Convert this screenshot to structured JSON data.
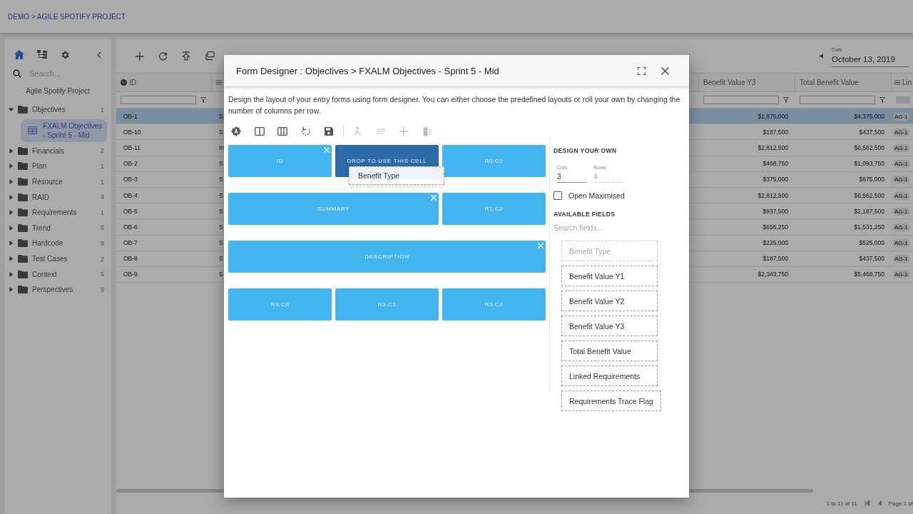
{
  "breadcrumb": "DEMO > AGILE SPOTIFY PROJECT",
  "sidebar": {
    "search_placeholder": "Search...",
    "project": "Agile Spotify Project",
    "tree": [
      {
        "label": "Objectives",
        "count": "1",
        "expanded": true,
        "children": [
          {
            "label": "FXALM Objectives - Sprint 5 - Mid",
            "selected": true
          }
        ]
      },
      {
        "label": "Financials",
        "count": "2",
        "expanded": false
      },
      {
        "label": "Plan",
        "count": "1",
        "expanded": false
      },
      {
        "label": "Resource",
        "count": "1",
        "expanded": false
      },
      {
        "label": "RAID",
        "count": "4",
        "expanded": false
      },
      {
        "label": "Requirements",
        "count": "1",
        "expanded": false
      },
      {
        "label": "Trend",
        "count": "6",
        "expanded": false
      },
      {
        "label": "Hardcode",
        "count": "9",
        "expanded": false
      },
      {
        "label": "Test Cases",
        "count": "2",
        "expanded": false
      },
      {
        "label": "Context",
        "count": "5",
        "expanded": false
      },
      {
        "label": "Perspectives",
        "count": "9",
        "expanded": false
      }
    ]
  },
  "date_field": {
    "label": "Date",
    "value": "October 13, 2019"
  },
  "table": {
    "headers": {
      "id": "ID",
      "benefit_value_y3": "Benefit Value Y3",
      "total_benefit_value": "Total Benefit Value",
      "column_last": "Lin"
    },
    "rows": [
      {
        "id": "OB-1",
        "column_2": "S",
        "benefit_value_y3": "$1,875,000",
        "total_benefit_value": "$4,375,000",
        "column_last": "AG-1",
        "selected": true
      },
      {
        "id": "OB-10",
        "column_2": "S",
        "benefit_value_y3": "$187,500",
        "total_benefit_value": "$437,500",
        "column_last": "AG-1",
        "selected": false
      },
      {
        "id": "OB-11",
        "column_2": "In",
        "benefit_value_y3": "$2,812,500",
        "total_benefit_value": "$6,562,500",
        "column_last": "AG-1",
        "selected": false
      },
      {
        "id": "OB-2",
        "column_2": "S",
        "benefit_value_y3": "$468,750",
        "total_benefit_value": "$1,093,750",
        "column_last": "AG-1",
        "selected": false
      },
      {
        "id": "OB-3",
        "column_2": "S",
        "benefit_value_y3": "$375,000",
        "total_benefit_value": "$875,000",
        "column_last": "AG-1",
        "selected": false
      },
      {
        "id": "OB-4",
        "column_2": "S",
        "benefit_value_y3": "$2,812,500",
        "total_benefit_value": "$6,562,500",
        "column_last": "AG-1",
        "selected": false
      },
      {
        "id": "OB-5",
        "column_2": "S",
        "benefit_value_y3": "$937,500",
        "total_benefit_value": "$2,187,500",
        "column_last": "AG-1",
        "selected": false
      },
      {
        "id": "OB-6",
        "column_2": "S",
        "benefit_value_y3": "$656,250",
        "total_benefit_value": "$1,531,250",
        "column_last": "AG-1",
        "selected": false
      },
      {
        "id": "OB-7",
        "column_2": "S",
        "benefit_value_y3": "$225,000",
        "total_benefit_value": "$525,000",
        "column_last": "AG-1",
        "selected": false
      },
      {
        "id": "OB-8",
        "column_2": "S",
        "benefit_value_y3": "$187,500",
        "total_benefit_value": "$437,500",
        "column_last": "AG-1",
        "selected": false
      },
      {
        "id": "OB-9",
        "column_2": "S",
        "benefit_value_y3": "$2,343,750",
        "total_benefit_value": "$5,468,750",
        "column_last": "AG-1",
        "selected": false
      }
    ]
  },
  "footer": {
    "count": "1 to 11 of 11",
    "page": "Page 1 of"
  },
  "modal": {
    "title": "Form Designer : Objectives > FXALM Objectives - Sprint 5 - Mid",
    "description": "Design the layout of your entry forms using form designer. You can either choose the predefined layouts or roll your own by changing the number of columns per row.",
    "tools": [
      {
        "kind": "auto",
        "disabled": false
      },
      {
        "kind": "two-columns",
        "disabled": false
      },
      {
        "kind": "three-columns",
        "disabled": false
      },
      {
        "kind": "reset",
        "disabled": false
      },
      {
        "kind": "save",
        "disabled": false
      },
      {
        "kind": "merge",
        "disabled": true
      },
      {
        "kind": "align",
        "disabled": true
      },
      {
        "kind": "add",
        "disabled": true
      },
      {
        "kind": "delete",
        "disabled": true
      }
    ],
    "grid": [
      {
        "cells": [
          {
            "label": "ID",
            "removable": true,
            "selected": false
          },
          {
            "label": "DROP TO USE THIS CELL",
            "removable": false,
            "selected": true
          },
          {
            "label": "R0:C2",
            "removable": false,
            "selected": false
          }
        ]
      },
      {
        "cells": [
          {
            "label": "SUMMARY",
            "removable": true,
            "selected": false
          },
          {
            "label": "R1:C2",
            "removable": false,
            "selected": false
          }
        ]
      },
      {
        "cells": [
          {
            "label": "DESCRIPTION",
            "removable": true,
            "selected": false
          }
        ]
      },
      {
        "cells": [
          {
            "label": "R3:C0",
            "removable": false,
            "selected": false
          },
          {
            "label": "R3:C1",
            "removable": false,
            "selected": false
          },
          {
            "label": "R3:C2",
            "removable": false,
            "selected": false
          }
        ]
      }
    ],
    "drag_ghost": {
      "label": "Benefit Type"
    },
    "design": {
      "heading": "DESIGN YOUR OWN",
      "cols": {
        "label": "Cols",
        "value": "3",
        "disabled": false
      },
      "rows": {
        "label": "Rows",
        "value": "4",
        "disabled": true
      },
      "open_maximised": {
        "label": "Open Maximised",
        "checked": false
      },
      "fields_heading": "AVAILABLE FIELDS",
      "search_placeholder": "Search fields...",
      "fields": [
        {
          "label": "Benefit Type",
          "disabled": true
        },
        {
          "label": "Benefit Value Y1",
          "disabled": false
        },
        {
          "label": "Benefit Value Y2",
          "disabled": false
        },
        {
          "label": "Benefit Value Y3",
          "disabled": false
        },
        {
          "label": "Total Benefit Value",
          "disabled": false
        },
        {
          "label": "Linked Requirements",
          "disabled": false
        },
        {
          "label": "Requirements Trace Flag",
          "disabled": false
        }
      ]
    }
  }
}
